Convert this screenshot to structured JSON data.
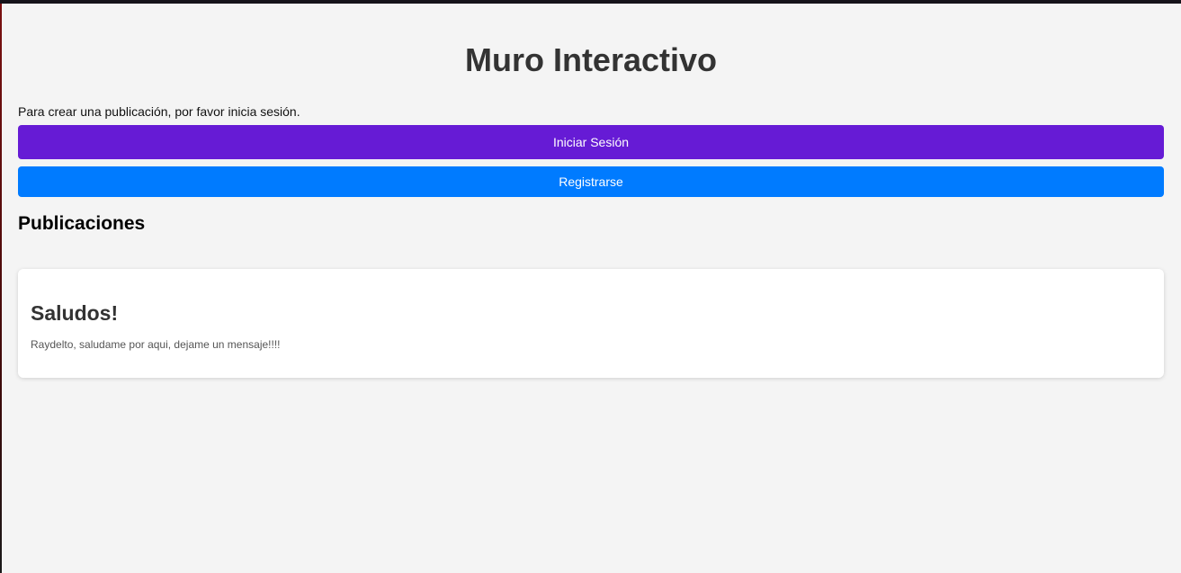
{
  "page": {
    "title": "Muro Interactivo",
    "login_prompt": "Para crear una publicación, por favor inicia sesión."
  },
  "auth": {
    "login_label": "Iniciar Sesión",
    "register_label": "Registrarse"
  },
  "posts_section": {
    "title": "Publicaciones",
    "posts": [
      {
        "title": "Saludos!",
        "body": "Raydelto, saludame por aqui, dejame un mensaje!!!!"
      }
    ]
  },
  "colors": {
    "background": "#f4f4f4",
    "login_button": "#661bd5",
    "register_button": "#007bff",
    "card": "#ffffff",
    "title_text": "#333333"
  }
}
